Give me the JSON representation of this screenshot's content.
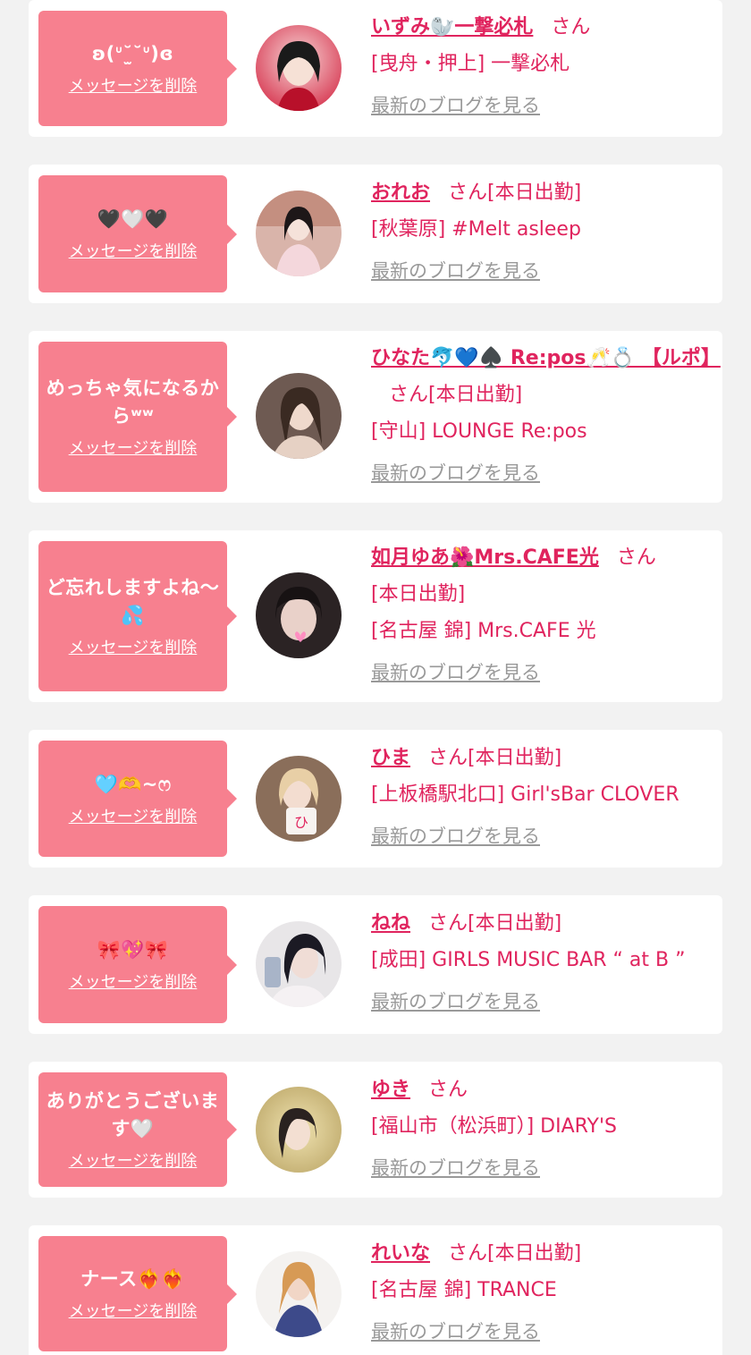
{
  "cards": [
    {
      "message": "ʚ(ᐡ˘̫˘ᐡ)ɞ",
      "delete_label": "メッセージを削除",
      "name": "いずみ🦭一撃必札",
      "san": "さん",
      "status": "",
      "shop": "[曳舟・押上] 一撃必札",
      "blog_label": "最新のブログを見る"
    },
    {
      "message": "🖤🤍🖤",
      "delete_label": "メッセージを削除",
      "name": "おれお",
      "san": "さん",
      "status": "[本日出勤]",
      "shop": "[秋葉原] #Melt asleep",
      "blog_label": "最新のブログを見る"
    },
    {
      "message": "めっちゃ気になるからʷʷ",
      "delete_label": "メッセージを削除",
      "name": "ひなた🐬💙♠️ Re:pos🥂💍 【ルポ】",
      "san": "さん",
      "status": "[本日出勤]",
      "shop": "[守山] LOUNGE Re:pos",
      "blog_label": "最新のブログを見る"
    },
    {
      "message": "ど忘れしますよね〜💦",
      "delete_label": "メッセージを削除",
      "name": "如月ゆあ🌺Mrs.CAFE光",
      "san": "さん",
      "status": "[本日出勤]",
      "shop": "[名古屋 錦] Mrs.CAFE 光",
      "blog_label": "最新のブログを見る"
    },
    {
      "message": "🩵🫶~ෆ",
      "delete_label": "メッセージを削除",
      "name": "ひま",
      "san": "さん",
      "status": "[本日出勤]",
      "shop": "[上板橋駅北口] Girl'sBar CLOVER",
      "blog_label": "最新のブログを見る"
    },
    {
      "message": "🎀💖🎀",
      "delete_label": "メッセージを削除",
      "name": "ねね",
      "san": "さん",
      "status": "[本日出勤]",
      "shop": "[成田] GIRLS MUSIC BAR “ at B ”",
      "blog_label": "最新のブログを見る"
    },
    {
      "message": "ありがとうございます🤍",
      "delete_label": "メッセージを削除",
      "name": "ゆき",
      "san": "さん",
      "status": "",
      "shop": "[福山市（松浜町）] DIARY'S",
      "blog_label": "最新のブログを見る"
    },
    {
      "message": "ナース❤️‍🔥❤️‍🔥",
      "delete_label": "メッセージを削除",
      "name": "れいな",
      "san": "さん",
      "status": "[本日出勤]",
      "shop": "[名古屋 錦] TRANCE",
      "blog_label": "最新のブログを見る"
    }
  ],
  "colors": {
    "bubble": "#f7808f",
    "name": "#e0245e",
    "link_gray": "#999999",
    "background": "#f2f2f2"
  }
}
